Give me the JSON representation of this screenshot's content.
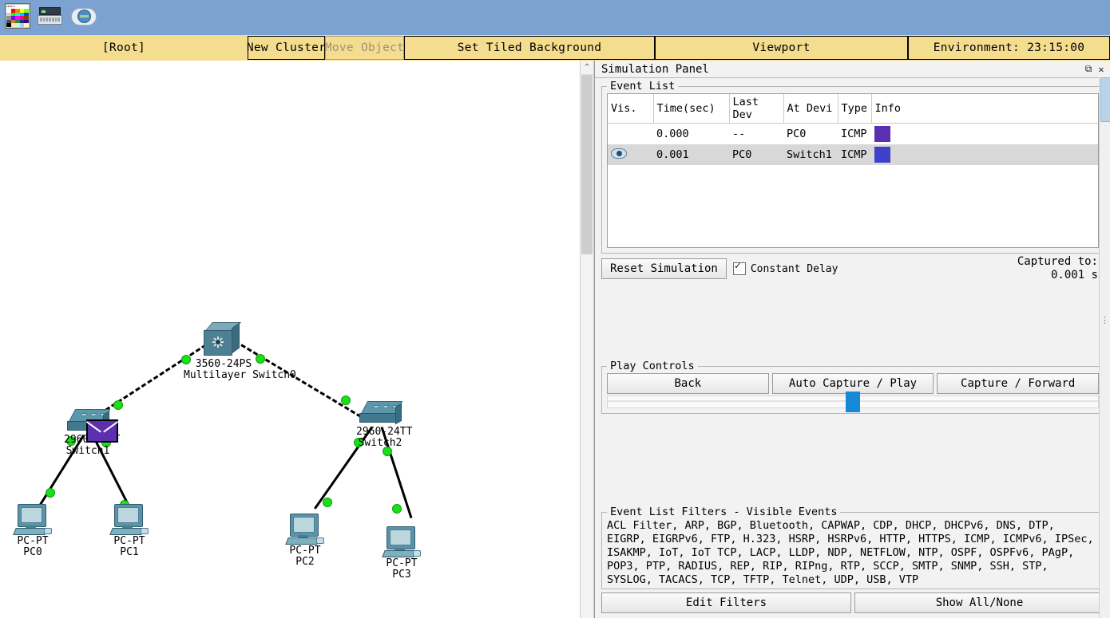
{
  "toolbar_icons": [
    {
      "name": "color-palette-icon",
      "label": "Palette"
    },
    {
      "name": "network-device-icon",
      "label": "Device"
    },
    {
      "name": "cloud-globe-icon",
      "label": "Cloud"
    }
  ],
  "cluster_bar": {
    "root_label": "[Root]",
    "new_cluster_label": "New Cluster",
    "move_object_label": "Move Object",
    "set_tiled_background_label": "Set Tiled Background",
    "viewport_label": "Viewport",
    "environment_label": "Environment: 23:15:00"
  },
  "topology": {
    "devices": [
      {
        "name": "multilayer-switch-0",
        "model": "3560-24PS",
        "label": "Multilayer Switch0"
      },
      {
        "name": "switch-1",
        "model": "2960-24TT",
        "label": "Switch1"
      },
      {
        "name": "switch-2",
        "model": "2960-24TT",
        "label": "Switch2"
      },
      {
        "name": "pc-0",
        "model": "PC-PT",
        "label": "PC0"
      },
      {
        "name": "pc-1",
        "model": "PC-PT",
        "label": "PC1"
      },
      {
        "name": "pc-2",
        "model": "PC-PT",
        "label": "PC2"
      },
      {
        "name": "pc-3",
        "model": "PC-PT",
        "label": "PC3"
      }
    ],
    "packet_color": "#5b2fb0",
    "link_status_color": "#19e019"
  },
  "simulation_panel": {
    "title": "Simulation Panel",
    "restore_icon": "restore-icon",
    "close_icon": "close-icon",
    "event_list": {
      "legend": "Event List",
      "columns": [
        "Vis.",
        "Time(sec)",
        "Last Dev",
        "At Devi",
        "Type",
        "Info"
      ],
      "rows": [
        {
          "vis": "",
          "time": "0.000",
          "last_dev": "--",
          "at_device": "PC0",
          "type": "ICMP",
          "info_color": "#5b2fb0",
          "selected": false
        },
        {
          "vis": "eye-icon",
          "time": "0.001",
          "last_dev": "PC0",
          "at_device": "Switch1",
          "type": "ICMP",
          "info_color": "#3f3fc8",
          "selected": true
        }
      ]
    },
    "reset_simulation_label": "Reset Simulation",
    "constant_delay_label": "Constant Delay",
    "constant_delay_checked": true,
    "captured_to_label": "Captured to:",
    "captured_to_value": "0.001 s",
    "play_controls": {
      "legend": "Play Controls",
      "back_label": "Back",
      "auto_capture_play_label": "Auto Capture / Play",
      "capture_forward_label": "Capture / Forward",
      "slider_position_percent": 50
    },
    "filters": {
      "legend": "Event List Filters - Visible Events",
      "protocols": "ACL Filter, ARP, BGP, Bluetooth, CAPWAP, CDP, DHCP, DHCPv6, DNS, DTP, EIGRP, EIGRPv6, FTP, H.323, HSRP, HSRPv6, HTTP, HTTPS, ICMP, ICMPv6, IPSec, ISAKMP, IoT, IoT TCP, LACP, LLDP, NDP, NETFLOW, NTP, OSPF, OSPFv6, PAgP, POP3, PTP, RADIUS, REP, RIP, RIPng, RTP, SCCP, SMTP, SNMP, SSH, STP, SYSLOG, TACACS, TCP, TFTP, Telnet, UDP, USB, VTP",
      "edit_filters_label": "Edit Filters",
      "show_all_none_label": "Show All/None"
    }
  }
}
